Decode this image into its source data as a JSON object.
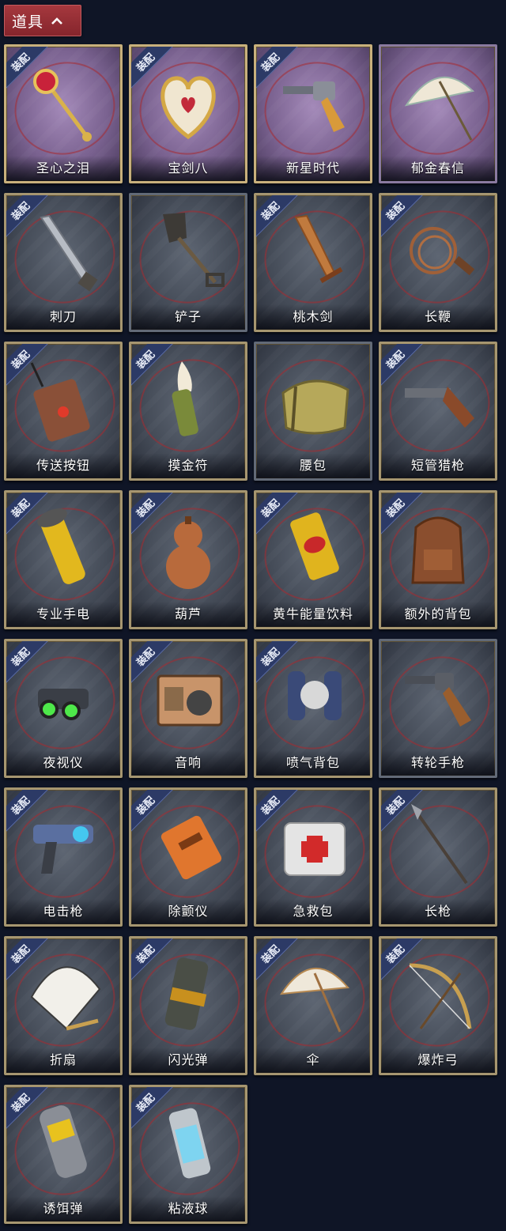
{
  "header": {
    "title": "道具",
    "chevron": "chevron-up-icon"
  },
  "badge_label": "装配",
  "colors": {
    "header_bg": "#98303a",
    "page_bg": "#0f1526",
    "card_gold": "#a69670",
    "badge_blue": "#2c3a66",
    "rare_violet": "#8e74a4"
  },
  "items": [
    {
      "name": "圣心之泪",
      "icon": "jeweled-scepter-icon",
      "equipped": true,
      "rarity": "violet"
    },
    {
      "name": "宝剑八",
      "icon": "heart-locket-icon",
      "equipped": true,
      "rarity": "violet"
    },
    {
      "name": "新星时代",
      "icon": "golden-revolver-icon",
      "equipped": true,
      "rarity": "violet"
    },
    {
      "name": "郁金春信",
      "icon": "paper-parasol-icon",
      "equipped": false,
      "rarity": "violet"
    },
    {
      "name": "刺刀",
      "icon": "bayonet-icon",
      "equipped": true,
      "rarity": "normal"
    },
    {
      "name": "铲子",
      "icon": "shovel-icon",
      "equipped": false,
      "rarity": "normal"
    },
    {
      "name": "桃木剑",
      "icon": "wooden-sword-icon",
      "equipped": true,
      "rarity": "normal"
    },
    {
      "name": "长鞭",
      "icon": "whip-icon",
      "equipped": true,
      "rarity": "normal"
    },
    {
      "name": "传送按钮",
      "icon": "teleport-remote-icon",
      "equipped": true,
      "rarity": "normal"
    },
    {
      "name": "摸金符",
      "icon": "talisman-claw-icon",
      "equipped": true,
      "rarity": "normal"
    },
    {
      "name": "腰包",
      "icon": "waist-bag-icon",
      "equipped": false,
      "rarity": "normal"
    },
    {
      "name": "短管猎枪",
      "icon": "sawed-off-shotgun-icon",
      "equipped": true,
      "rarity": "normal"
    },
    {
      "name": "专业手电",
      "icon": "flashlight-icon",
      "equipped": true,
      "rarity": "normal"
    },
    {
      "name": "葫芦",
      "icon": "gourd-icon",
      "equipped": true,
      "rarity": "normal"
    },
    {
      "name": "黄牛能量饮料",
      "icon": "energy-drink-can-icon",
      "equipped": true,
      "rarity": "normal"
    },
    {
      "name": "额外的背包",
      "icon": "backpack-icon",
      "equipped": true,
      "rarity": "normal"
    },
    {
      "name": "夜视仪",
      "icon": "night-vision-goggles-icon",
      "equipped": true,
      "rarity": "normal"
    },
    {
      "name": "音响",
      "icon": "boombox-icon",
      "equipped": true,
      "rarity": "normal"
    },
    {
      "name": "喷气背包",
      "icon": "jetpack-icon",
      "equipped": true,
      "rarity": "normal"
    },
    {
      "name": "转轮手枪",
      "icon": "revolver-icon",
      "equipped": false,
      "rarity": "normal"
    },
    {
      "name": "电击枪",
      "icon": "stun-gun-icon",
      "equipped": true,
      "rarity": "normal"
    },
    {
      "name": "除颤仪",
      "icon": "defibrillator-icon",
      "equipped": true,
      "rarity": "normal"
    },
    {
      "name": "急救包",
      "icon": "first-aid-kit-icon",
      "equipped": true,
      "rarity": "normal"
    },
    {
      "name": "长枪",
      "icon": "spear-icon",
      "equipped": true,
      "rarity": "normal"
    },
    {
      "name": "折扇",
      "icon": "folding-fan-icon",
      "equipped": true,
      "rarity": "normal"
    },
    {
      "name": "闪光弹",
      "icon": "flashbang-icon",
      "equipped": true,
      "rarity": "normal"
    },
    {
      "name": "伞",
      "icon": "umbrella-icon",
      "equipped": true,
      "rarity": "normal"
    },
    {
      "name": "爆炸弓",
      "icon": "explosive-bow-icon",
      "equipped": true,
      "rarity": "normal"
    },
    {
      "name": "诱饵弹",
      "icon": "decoy-grenade-icon",
      "equipped": true,
      "rarity": "normal"
    },
    {
      "name": "粘液球",
      "icon": "slime-capsule-icon",
      "equipped": true,
      "rarity": "normal"
    }
  ]
}
